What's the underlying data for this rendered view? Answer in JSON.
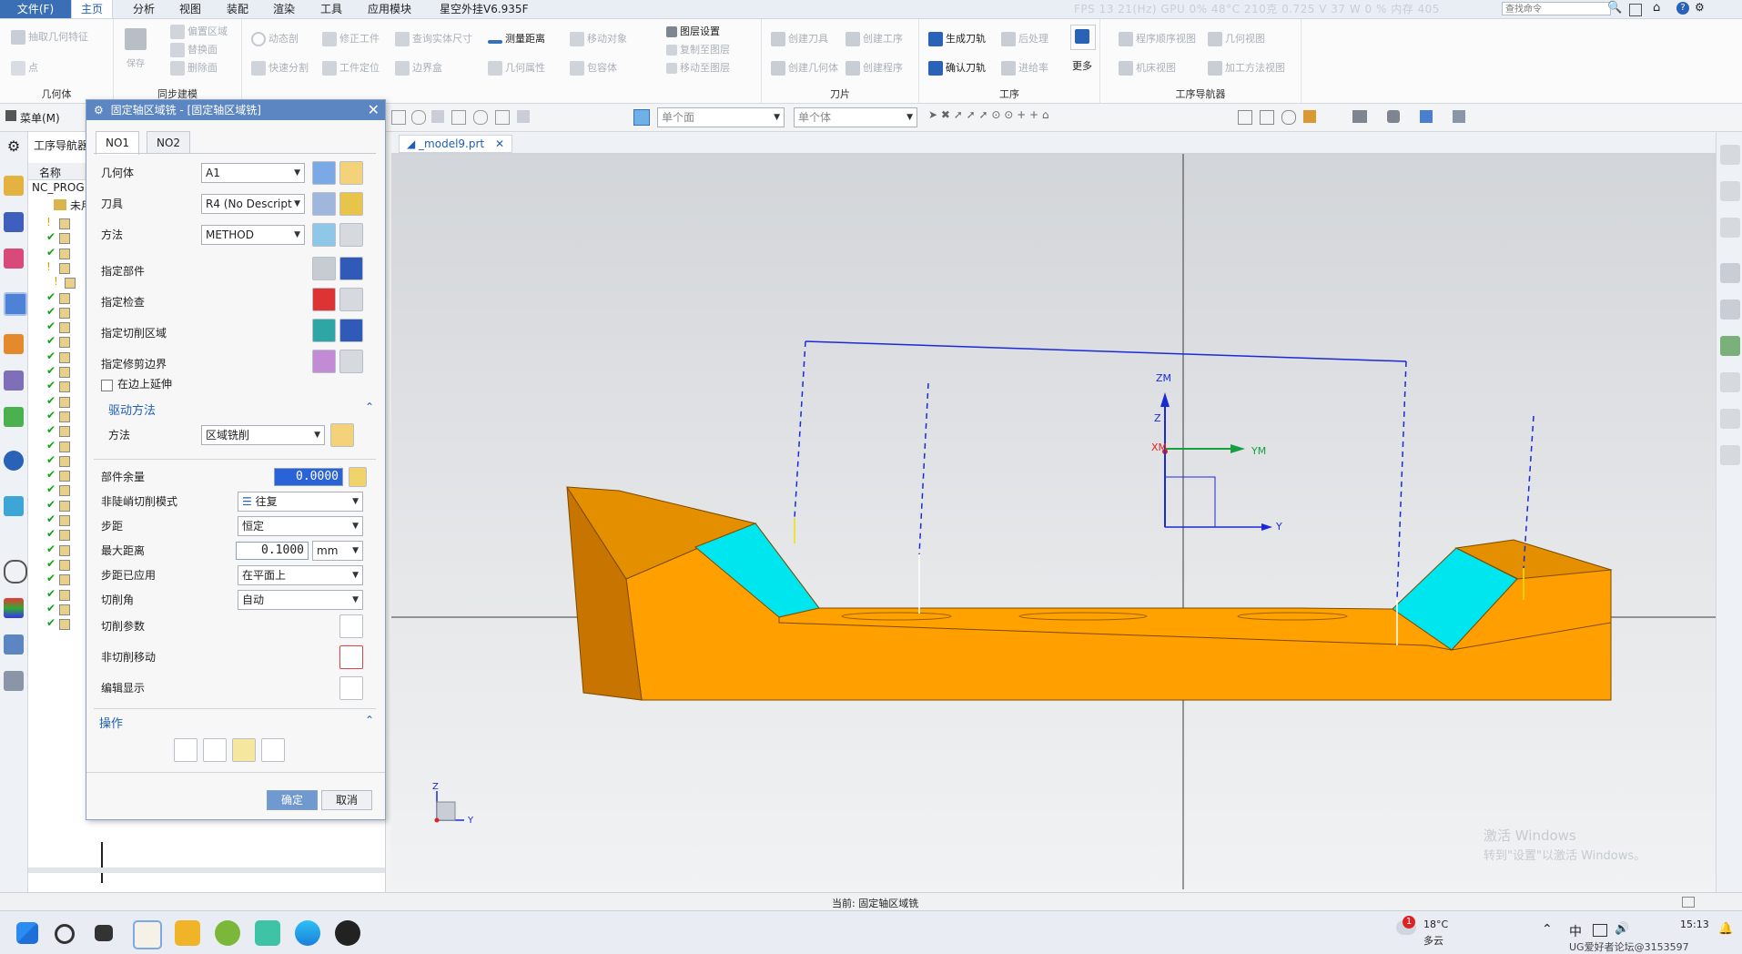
{
  "menubar": {
    "file": "文件(F)",
    "items": [
      "主页",
      "分析",
      "视图",
      "装配",
      "渲染",
      "工具",
      "应用模块",
      "星空外挂V6.935F"
    ],
    "active_index": 0,
    "status_text": "FPS 13 21(Hz) GPU 0% 48°C 210克 0.725 V 37 W 0 % 内存 405",
    "search_placeholder": "查找命令"
  },
  "ribbon": {
    "groups": [
      {
        "label": "几何体",
        "items": [
          "抽取几何特征",
          "点"
        ]
      },
      {
        "label": "同步建模",
        "items": [
          "保存",
          "偏置区域",
          "替换面",
          "删除面"
        ]
      },
      {
        "label": "",
        "items": [
          "动态剖",
          "修正工件",
          "查询实体尺寸",
          "快速分割",
          "工件定位",
          "边界盒",
          "测量距离",
          "移动对象",
          "几何属性",
          "包容体",
          "图层设置",
          "复制至图层",
          "移动至图层"
        ]
      },
      {
        "label": "刀片",
        "items": [
          "创建刀具",
          "创建工序",
          "创建几何体",
          "创建程序"
        ]
      },
      {
        "label": "工序",
        "items": [
          "生成刀轨",
          "后处理",
          "确认刀轨",
          "进给率",
          "更多"
        ]
      },
      {
        "label": "工序导航器",
        "items": [
          "程序顺序视图",
          "几何视图",
          "机床视图",
          "加工方法视图"
        ]
      }
    ]
  },
  "toolbar2": {
    "menu_label": "菜单(M)",
    "filter1": "单个面",
    "filter2": "单个体"
  },
  "navigator": {
    "title": "工序导航器",
    "column": "名称",
    "root": "NC_PROG",
    "unused": "未用"
  },
  "dialog": {
    "title": "固定轴区域铣 - [固定轴区域铣]",
    "tabs": [
      "NO1",
      "NO2"
    ],
    "geometry_label": "几何体",
    "geometry_value": "A1",
    "tool_label": "刀具",
    "tool_value": "R4 (No Descript",
    "method_label": "方法",
    "method_value": "METHOD",
    "specify_part": "指定部件",
    "specify_check": "指定检查",
    "specify_cut_area": "指定切削区域",
    "specify_trim": "指定修剪边界",
    "extend_edge": "在边上延伸",
    "drive_section": "驱动方法",
    "drive_method_label": "方法",
    "drive_method_value": "区域铣削",
    "part_stock_label": "部件余量",
    "part_stock_value": "0.0000",
    "nonsteep_label": "非陡峭切削模式",
    "nonsteep_value": "往复",
    "stepover_label": "步距",
    "stepover_value": "恒定",
    "maxdist_label": "最大距离",
    "maxdist_value": "0.1000",
    "maxdist_unit": "mm",
    "stepover_applied_label": "步距已应用",
    "stepover_applied_value": "在平面上",
    "cut_angle_label": "切削角",
    "cut_angle_value": "自动",
    "cut_params": "切削参数",
    "noncut_moves": "非切削移动",
    "edit_display": "编辑显示",
    "actions_section": "操作",
    "ok": "确定",
    "cancel": "取消"
  },
  "viewport": {
    "tab_name": "_model9.prt",
    "axis_zm": "ZM",
    "axis_ym": "YM",
    "axis_xm": "XM",
    "axis_z": "Z",
    "axis_y": "Y",
    "triad_z": "Z",
    "triad_y": "Y",
    "watermark1": "激活 Windows",
    "watermark2": "转到\"设置\"以激活 Windows。"
  },
  "statusbar": {
    "current": "当前: 固定轴区域铣"
  },
  "taskbar": {
    "weather_temp": "18°C",
    "weather_desc": "多云",
    "badge": "1",
    "time": "15:13",
    "lang": "中",
    "watermark": "UG爱好者论坛@3153597"
  },
  "colors": {
    "accent": "#1e5fb4",
    "dialog_title": "#5b86c2",
    "part_orange": "#ffa000",
    "part_dark": "#c77a00",
    "cyan_face": "#00e5ee",
    "toolpath_blue": "#1a2ad6"
  }
}
